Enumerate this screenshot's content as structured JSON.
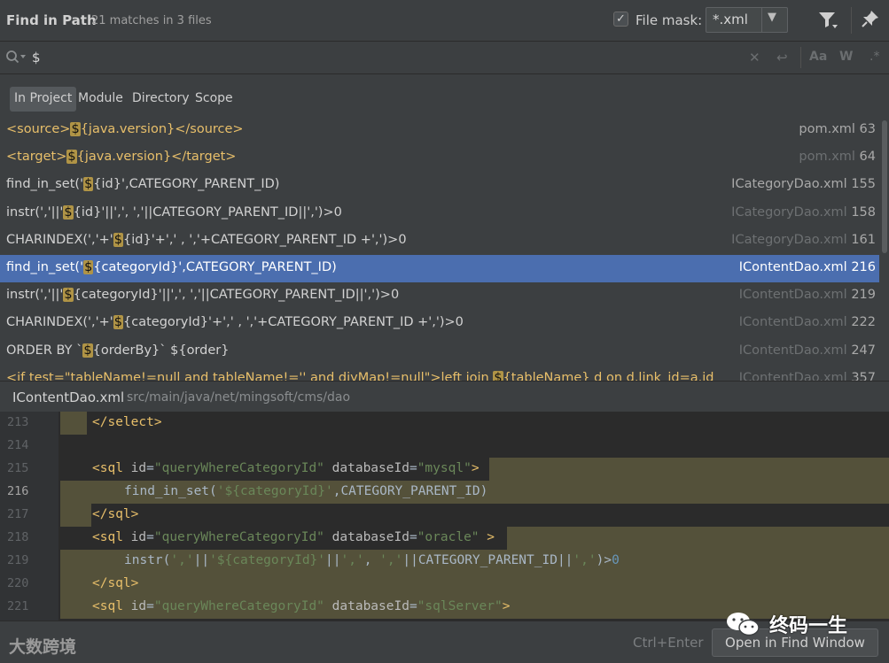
{
  "header": {
    "title": "Find in Path",
    "match_summary": "21 matches in 3 files",
    "file_mask_label": "File mask:",
    "file_mask_checked": "✓",
    "file_mask_value": "*.xml"
  },
  "search": {
    "query": "$"
  },
  "scope_tabs": [
    "In Project",
    "Module",
    "Directory",
    "Scope"
  ],
  "results": [
    {
      "pre": "<source>",
      "match": "$",
      "post": "{java.version}</source>",
      "file": "pom.xml",
      "line": "63",
      "dim_file": false,
      "xml": true,
      "selected": false
    },
    {
      "pre": "<target>",
      "match": "$",
      "post": "{java.version}</target>",
      "file": "pom.xml",
      "line": "64",
      "dim_file": true,
      "xml": true,
      "selected": false
    },
    {
      "pre": "find_in_set('",
      "match": "$",
      "post": "{id}',CATEGORY_PARENT_ID)",
      "file": "ICategoryDao.xml",
      "line": "155",
      "dim_file": false,
      "xml": false,
      "selected": false
    },
    {
      "pre": "instr(','||'",
      "match": "$",
      "post": "{id}'||',', ','||CATEGORY_PARENT_ID||',')>0",
      "file": "ICategoryDao.xml",
      "line": "158",
      "dim_file": true,
      "xml": false,
      "selected": false
    },
    {
      "pre": "CHARINDEX(','+'",
      "match": "$",
      "post": "{id}'+',' , ','+CATEGORY_PARENT_ID +',')>0",
      "file": "ICategoryDao.xml",
      "line": "161",
      "dim_file": true,
      "xml": false,
      "selected": false
    },
    {
      "pre": "find_in_set('",
      "match": "$",
      "post": "{categoryId}',CATEGORY_PARENT_ID)",
      "file": "IContentDao.xml",
      "line": "216",
      "dim_file": false,
      "xml": false,
      "selected": true
    },
    {
      "pre": "instr(','||'",
      "match": "$",
      "post": "{categoryId}'||',', ','||CATEGORY_PARENT_ID||',')>0",
      "file": "IContentDao.xml",
      "line": "219",
      "dim_file": true,
      "xml": false,
      "selected": false
    },
    {
      "pre": "CHARINDEX(','+'",
      "match": "$",
      "post": "{categoryId}'+',' , ','+CATEGORY_PARENT_ID +',')>0",
      "file": "IContentDao.xml",
      "line": "222",
      "dim_file": true,
      "xml": false,
      "selected": false
    },
    {
      "pre": "ORDER BY `",
      "match": "$",
      "post": "{orderBy}` ${order}",
      "file": "IContentDao.xml",
      "line": "247",
      "dim_file": true,
      "xml": false,
      "selected": false
    },
    {
      "pre": "<if test=\"tableName!=null and tableName!='' and diyMap!=null\">left join ",
      "match": "$",
      "post": "{tableName} d on d.link_id=a.id",
      "file": "IContentDao.xml",
      "line": "357",
      "dim_file": true,
      "xml": true,
      "selected": false
    }
  ],
  "preview": {
    "file_name": "IContentDao.xml",
    "file_path": "src/main/java/net/mingsoft/cms/dao",
    "lines": [
      {
        "n": "213",
        "text": "</select>"
      },
      {
        "n": "214",
        "text": ""
      },
      {
        "n": "215",
        "text": "<sql id=\"queryWhereCategoryId\" databaseId=\"mysql\">"
      },
      {
        "n": "216",
        "text": "find_in_set('${categoryId}',CATEGORY_PARENT_ID)"
      },
      {
        "n": "217",
        "text": "</sql>"
      },
      {
        "n": "218",
        "text": "<sql id=\"queryWhereCategoryId\" databaseId=\"oracle\" >"
      },
      {
        "n": "219",
        "text": "instr(','||'${categoryId}'||',', ','||CATEGORY_PARENT_ID||',')>0"
      },
      {
        "n": "220",
        "text": "</sql>"
      },
      {
        "n": "221",
        "text": "<sql id=\"queryWhereCategoryId\" databaseId=\"sqlServer\">"
      }
    ]
  },
  "footer": {
    "shortcut": "Ctrl+Enter",
    "open_button": "Open in Find Window"
  },
  "watermarks": {
    "left": "大数跨境",
    "right": "终码一生"
  }
}
